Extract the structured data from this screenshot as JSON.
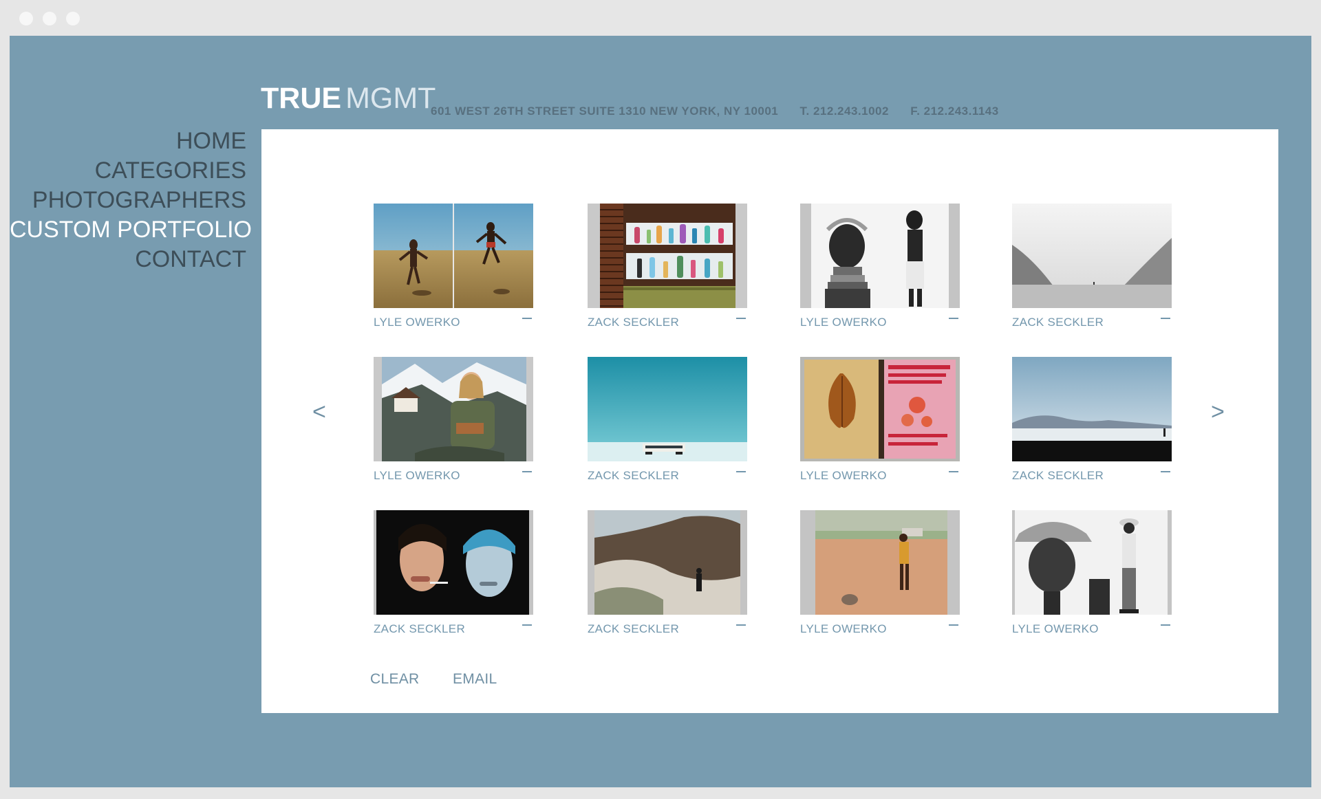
{
  "window": {
    "controls": [
      "close-dot",
      "minimize-dot",
      "zoom-dot"
    ]
  },
  "header": {
    "logo_bold": "TRUE",
    "logo_light": "MGMT",
    "address": "601 WEST 26TH STREET SUITE 1310 NEW YORK, NY 10001",
    "phone": "T. 212.243.1002",
    "fax": "F. 212.243.1143"
  },
  "nav": {
    "items": [
      {
        "label": "HOME"
      },
      {
        "label": "CATEGORIES"
      },
      {
        "label": "PHOTOGRAPHERS"
      },
      {
        "label": "CUSTOM PORTFOLIO",
        "active": true
      },
      {
        "label": "CONTACT"
      }
    ]
  },
  "portfolio": {
    "prev_arrow": "<",
    "next_arrow": ">",
    "remove_icon": "minus-icon",
    "items": [
      {
        "photographer": "LYLE OWERKO",
        "image": "kids-jumping-diptych"
      },
      {
        "photographer": "ZACK SECKLER",
        "image": "bar-bottle-shelf"
      },
      {
        "photographer": "LYLE OWERKO",
        "image": "tribal-portraits-bw"
      },
      {
        "photographer": "ZACK SECKLER",
        "image": "misty-valley"
      },
      {
        "photographer": "LYLE OWERKO",
        "image": "girl-snowy-mountains"
      },
      {
        "photographer": "ZACK SECKLER",
        "image": "salt-flat-bus"
      },
      {
        "photographer": "LYLE OWERKO",
        "image": "sketchbook-leaf"
      },
      {
        "photographer": "ZACK SECKLER",
        "image": "horizon-lake"
      },
      {
        "photographer": "ZACK SECKLER",
        "image": "two-women-portrait"
      },
      {
        "photographer": "ZACK SECKLER",
        "image": "foggy-hills-figure"
      },
      {
        "photographer": "LYLE OWERKO",
        "image": "man-on-sand-field"
      },
      {
        "photographer": "LYLE OWERKO",
        "image": "old-man-hat-bw"
      }
    ],
    "clear_label": "CLEAR",
    "email_label": "EMAIL"
  },
  "colors": {
    "frame": "#e6e6e6",
    "background": "#789cb0",
    "panel": "#ffffff",
    "caption": "#7397ad",
    "nav_text": "#3d4e58",
    "nav_active": "#ffffff"
  }
}
